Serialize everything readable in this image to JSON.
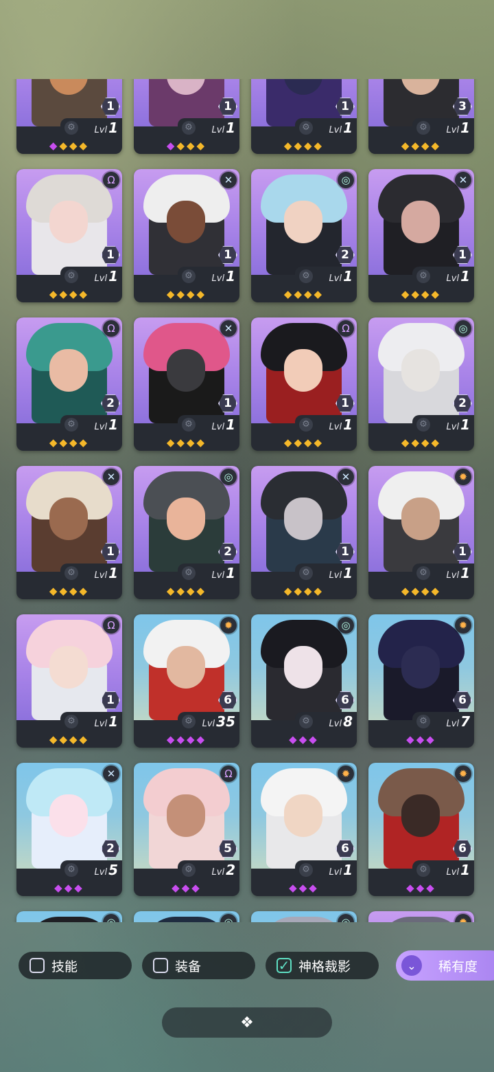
{
  "filters": {
    "skill_label": "技能",
    "equipment_label": "装备",
    "divinity_label": "神格裁影",
    "rarity_label": "稀有度"
  },
  "heroes": [
    {
      "faction": "void-icon",
      "stars": "1",
      "lvl_label": "Lvl",
      "level": "1",
      "gems": [
        [
          "purple",
          "◆"
        ],
        [
          "gold",
          "◆"
        ],
        [
          "gold",
          "◆"
        ],
        [
          "gold",
          "◆"
        ]
      ],
      "bg": "purple",
      "palette": [
        "#5b4a3e",
        "#2b2420",
        "#c98a5c"
      ]
    },
    {
      "faction": "void-icon",
      "stars": "1",
      "lvl_label": "Lvl",
      "level": "1",
      "gems": [
        [
          "purple",
          "◆"
        ],
        [
          "gold",
          "◆"
        ],
        [
          "gold",
          "◆"
        ],
        [
          "gold",
          "◆"
        ]
      ],
      "bg": "purple",
      "palette": [
        "#6b3a6a",
        "#3b2b3d",
        "#d9b3c6"
      ]
    },
    {
      "faction": "void-icon",
      "stars": "1",
      "lvl_label": "Lvl",
      "level": "1",
      "gems": [
        [
          "gold",
          "◆"
        ],
        [
          "gold",
          "◆"
        ],
        [
          "gold",
          "◆"
        ],
        [
          "gold",
          "◆"
        ]
      ],
      "bg": "purple",
      "palette": [
        "#3a2b6a",
        "#a3d1e0",
        "#2b2b52"
      ]
    },
    {
      "faction": "void-icon",
      "stars": "3",
      "lvl_label": "Lvl",
      "level": "1",
      "gems": [
        [
          "gold",
          "◆"
        ],
        [
          "gold",
          "◆"
        ],
        [
          "gold",
          "◆"
        ],
        [
          "gold",
          "◆"
        ]
      ],
      "bg": "purple",
      "palette": [
        "#2c2c30",
        "#e6e6ea",
        "#d9b39c"
      ]
    },
    {
      "faction": "void-icon",
      "stars": "1",
      "lvl_label": "Lvl",
      "level": "1",
      "gems": [
        [
          "gold",
          "◆"
        ],
        [
          "gold",
          "◆"
        ],
        [
          "gold",
          "◆"
        ],
        [
          "gold",
          "◆"
        ]
      ],
      "bg": "purple",
      "palette": [
        "#e8e6ea",
        "#dedad6",
        "#f3d6d0"
      ]
    },
    {
      "faction": "nexus-icon",
      "stars": "1",
      "lvl_label": "Lvl",
      "level": "1",
      "gems": [
        [
          "gold",
          "◆"
        ],
        [
          "gold",
          "◆"
        ],
        [
          "gold",
          "◆"
        ],
        [
          "gold",
          "◆"
        ]
      ],
      "bg": "purple",
      "palette": [
        "#303036",
        "#eeeeee",
        "#7a4c38"
      ]
    },
    {
      "faction": "storm-icon",
      "stars": "2",
      "lvl_label": "Lvl",
      "level": "1",
      "gems": [
        [
          "gold",
          "◆"
        ],
        [
          "gold",
          "◆"
        ],
        [
          "gold",
          "◆"
        ],
        [
          "gold",
          "◆"
        ]
      ],
      "bg": "purple",
      "palette": [
        "#23262e",
        "#a9d8ec",
        "#f0d2c2"
      ]
    },
    {
      "faction": "nexus-icon",
      "stars": "1",
      "lvl_label": "Lvl",
      "level": "1",
      "gems": [
        [
          "gold",
          "◆"
        ],
        [
          "gold",
          "◆"
        ],
        [
          "gold",
          "◆"
        ],
        [
          "gold",
          "◆"
        ]
      ],
      "bg": "purple",
      "palette": [
        "#1f1f24",
        "#2b2b30",
        "#d5a9a0"
      ]
    },
    {
      "faction": "void-icon",
      "stars": "2",
      "lvl_label": "Lvl",
      "level": "1",
      "gems": [
        [
          "gold",
          "◆"
        ],
        [
          "gold",
          "◆"
        ],
        [
          "gold",
          "◆"
        ],
        [
          "gold",
          "◆"
        ]
      ],
      "bg": "purple",
      "palette": [
        "#1f5a56",
        "#3a9a8e",
        "#e9bba4"
      ]
    },
    {
      "faction": "nexus-icon",
      "stars": "1",
      "lvl_label": "Lvl",
      "level": "1",
      "gems": [
        [
          "gold",
          "◆"
        ],
        [
          "gold",
          "◆"
        ],
        [
          "gold",
          "◆"
        ],
        [
          "gold",
          "◆"
        ]
      ],
      "bg": "purple",
      "palette": [
        "#1a1a1a",
        "#e0578a",
        "#3a3a3e"
      ]
    },
    {
      "faction": "void-icon",
      "stars": "1",
      "lvl_label": "Lvl",
      "level": "1",
      "gems": [
        [
          "gold",
          "◆"
        ],
        [
          "gold",
          "◆"
        ],
        [
          "gold",
          "◆"
        ],
        [
          "gold",
          "◆"
        ]
      ],
      "bg": "purple",
      "palette": [
        "#9a1f20",
        "#1a1a1e",
        "#f2ccb8"
      ]
    },
    {
      "faction": "storm-icon",
      "stars": "2",
      "lvl_label": "Lvl",
      "level": "1",
      "gems": [
        [
          "gold",
          "◆"
        ],
        [
          "gold",
          "◆"
        ],
        [
          "gold",
          "◆"
        ],
        [
          "gold",
          "◆"
        ]
      ],
      "bg": "purple",
      "palette": [
        "#d8d8dc",
        "#ededf0",
        "#e6e3e0"
      ]
    },
    {
      "faction": "nexus-icon",
      "stars": "1",
      "lvl_label": "Lvl",
      "level": "1",
      "gems": [
        [
          "gold",
          "◆"
        ],
        [
          "gold",
          "◆"
        ],
        [
          "gold",
          "◆"
        ],
        [
          "gold",
          "◆"
        ]
      ],
      "bg": "purple",
      "palette": [
        "#5a3d30",
        "#e7dccb",
        "#9a6a4f"
      ]
    },
    {
      "faction": "storm-icon",
      "stars": "2",
      "lvl_label": "Lvl",
      "level": "1",
      "gems": [
        [
          "gold",
          "◆"
        ],
        [
          "gold",
          "◆"
        ],
        [
          "gold",
          "◆"
        ],
        [
          "gold",
          "◆"
        ]
      ],
      "bg": "purple",
      "palette": [
        "#2b3c3a",
        "#4b4f54",
        "#e9b49a"
      ]
    },
    {
      "faction": "nexus-icon",
      "stars": "1",
      "lvl_label": "Lvl",
      "level": "1",
      "gems": [
        [
          "gold",
          "◆"
        ],
        [
          "gold",
          "◆"
        ],
        [
          "gold",
          "◆"
        ],
        [
          "gold",
          "◆"
        ]
      ],
      "bg": "purple",
      "palette": [
        "#2a3a4a",
        "#2a2d33",
        "#c8c2c8"
      ]
    },
    {
      "faction": "solar-icon",
      "stars": "1",
      "lvl_label": "Lvl",
      "level": "1",
      "gems": [
        [
          "gold",
          "◆"
        ],
        [
          "gold",
          "◆"
        ],
        [
          "gold",
          "◆"
        ],
        [
          "gold",
          "◆"
        ]
      ],
      "bg": "purple",
      "palette": [
        "#3a3a3e",
        "#efefef",
        "#c8a087"
      ]
    },
    {
      "faction": "void-icon",
      "stars": "1",
      "lvl_label": "Lvl",
      "level": "1",
      "gems": [
        [
          "gold",
          "◆"
        ],
        [
          "gold",
          "◆"
        ],
        [
          "gold",
          "◆"
        ],
        [
          "gold",
          "◆"
        ]
      ],
      "bg": "purple",
      "palette": [
        "#e6e8ee",
        "#f6d2dc",
        "#f4dcd2"
      ]
    },
    {
      "faction": "solar-icon",
      "stars": "6",
      "lvl_label": "Lvl",
      "level": "35",
      "gems": [
        [
          "purple",
          "◆"
        ],
        [
          "purple",
          "◆"
        ],
        [
          "purple",
          "◆"
        ],
        [
          "purple",
          "◆"
        ]
      ],
      "bg": "sky",
      "palette": [
        "#c0302a",
        "#f2f2f2",
        "#e2b8a0"
      ]
    },
    {
      "faction": "storm-icon",
      "stars": "6",
      "lvl_label": "Lvl",
      "level": "8",
      "gems": [
        [
          "purple",
          "◆"
        ],
        [
          "purple",
          "◆"
        ],
        [
          "purple",
          "◆"
        ]
      ],
      "bg": "sky",
      "palette": [
        "#2a2a30",
        "#1a1a20",
        "#eee2e8"
      ]
    },
    {
      "faction": "solar-icon",
      "stars": "6",
      "lvl_label": "Lvl",
      "level": "7",
      "gems": [
        [
          "purple",
          "◆"
        ],
        [
          "purple",
          "◆"
        ],
        [
          "purple",
          "◆"
        ]
      ],
      "bg": "sky",
      "palette": [
        "#1a1a2a",
        "#23234a",
        "#2c2c52"
      ]
    },
    {
      "faction": "nexus-icon",
      "stars": "2",
      "lvl_label": "Lvl",
      "level": "5",
      "gems": [
        [
          "purple",
          "◆"
        ],
        [
          "purple",
          "◆"
        ],
        [
          "purple",
          "◆"
        ]
      ],
      "bg": "sky",
      "palette": [
        "#e6eefb",
        "#bfe9f6",
        "#fbe0ea"
      ]
    },
    {
      "faction": "void-icon",
      "stars": "5",
      "lvl_label": "Lvl",
      "level": "2",
      "gems": [
        [
          "purple",
          "◆"
        ],
        [
          "purple",
          "◆"
        ],
        [
          "purple",
          "◆"
        ]
      ],
      "bg": "sky",
      "palette": [
        "#f1d6d6",
        "#f3cdd0",
        "#c49078"
      ]
    },
    {
      "faction": "solar-icon",
      "stars": "6",
      "lvl_label": "Lvl",
      "level": "1",
      "gems": [
        [
          "purple",
          "◆"
        ],
        [
          "purple",
          "◆"
        ],
        [
          "purple",
          "◆"
        ]
      ],
      "bg": "sky",
      "palette": [
        "#e8e8ea",
        "#f4f4f4",
        "#f0d6c4"
      ]
    },
    {
      "faction": "solar-icon",
      "stars": "6",
      "lvl_label": "Lvl",
      "level": "1",
      "gems": [
        [
          "purple",
          "◆"
        ],
        [
          "purple",
          "◆"
        ],
        [
          "purple",
          "◆"
        ]
      ],
      "bg": "sky",
      "palette": [
        "#b02424",
        "#7a5a4a",
        "#3a2a26"
      ]
    },
    {
      "faction": "storm-icon",
      "stars": "",
      "lvl_label": "",
      "level": "",
      "gems": [],
      "bg": "sky",
      "palette": [
        "#2a2a30",
        "#1f1f24",
        "#b02424"
      ]
    },
    {
      "faction": "storm-icon",
      "stars": "",
      "lvl_label": "",
      "level": "",
      "gems": [],
      "bg": "sky",
      "palette": [
        "#2a3c56",
        "#1f2c40",
        "#3a4a66"
      ]
    },
    {
      "faction": "storm-icon",
      "stars": "",
      "lvl_label": "",
      "level": "",
      "gems": [],
      "bg": "sky",
      "palette": [
        "#6a6a80",
        "#a8a8b8",
        "#3a3a4a"
      ]
    },
    {
      "faction": "solar-icon",
      "stars": "",
      "lvl_label": "",
      "level": "",
      "gems": [],
      "bg": "purple",
      "palette": [
        "#5a4a5a",
        "#6a6a7a",
        "#b8a4b0"
      ]
    }
  ],
  "icons": {
    "void-icon": "Ω",
    "nexus-icon": "✕",
    "storm-icon": "◎",
    "solar-icon": "✹",
    "gear-icon": "⚙",
    "check-icon": "✓",
    "rarity-icon": "⌄",
    "collapse-icon": "❖"
  }
}
